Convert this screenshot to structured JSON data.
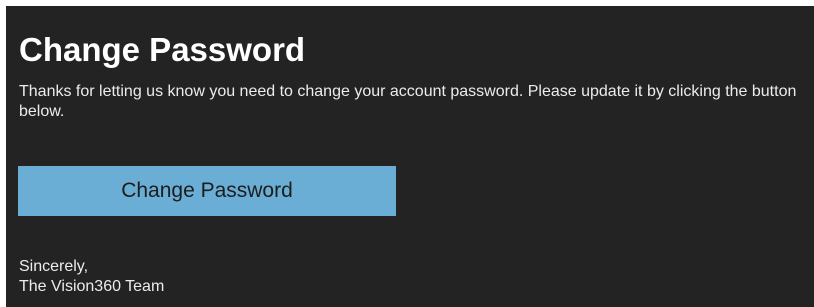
{
  "email": {
    "title": "Change Password",
    "message": "Thanks for letting us know you need to change your account password. Please update it by clicking the button below.",
    "button_label": "Change Password",
    "signoff_line_1": "Sincerely,",
    "signoff_line_2": "The Vision360 Team"
  },
  "colors": {
    "card_background": "#232323",
    "button_background": "#6aaed6",
    "text": "#ececec"
  }
}
